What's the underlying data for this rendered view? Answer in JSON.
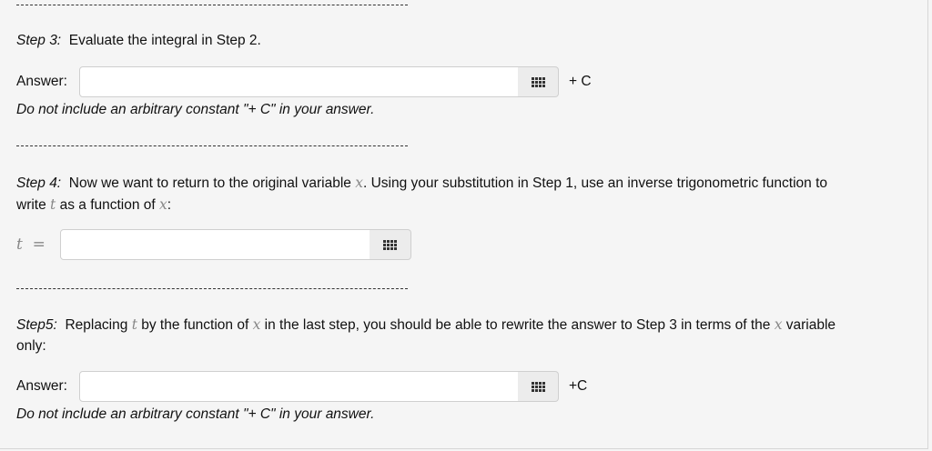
{
  "separator": "-----",
  "step3": {
    "label": "Step 3:",
    "text": "Evaluate the integral in Step 2.",
    "answer_label": "Answer:",
    "answer_value": "",
    "suffix": "+ C",
    "note": "Do not include an arbitrary constant \"+ C\" in your answer."
  },
  "step4": {
    "label": "Step 4:",
    "line1_a": "Now we want to return to the original variable ",
    "line1_var": "x",
    "line1_b": ". Using your substitution in Step 1, use an inverse trigonometric function to",
    "line2_a": "write ",
    "line2_var": "t",
    "line2_b": " as a function of ",
    "line2_var2": "x",
    "line2_c": ":",
    "eq_lhs": "t",
    "eq_sign": "=",
    "answer_value": ""
  },
  "step5": {
    "label": "Step5:",
    "line1_a": "Replacing ",
    "line1_var": "t",
    "line1_b": " by the function of ",
    "line1_var2": "x",
    "line1_c": " in the last step, you should be able to rewrite the answer to Step 3 in terms of the ",
    "line1_var3": "x",
    "line1_d": " variable",
    "line2": "only:",
    "answer_label": "Answer:",
    "answer_value": "",
    "suffix": "+C",
    "note": "Do not include an arbitrary constant \"+ C\" in your answer."
  },
  "icons": {
    "palette": "grid-keypad-icon"
  }
}
